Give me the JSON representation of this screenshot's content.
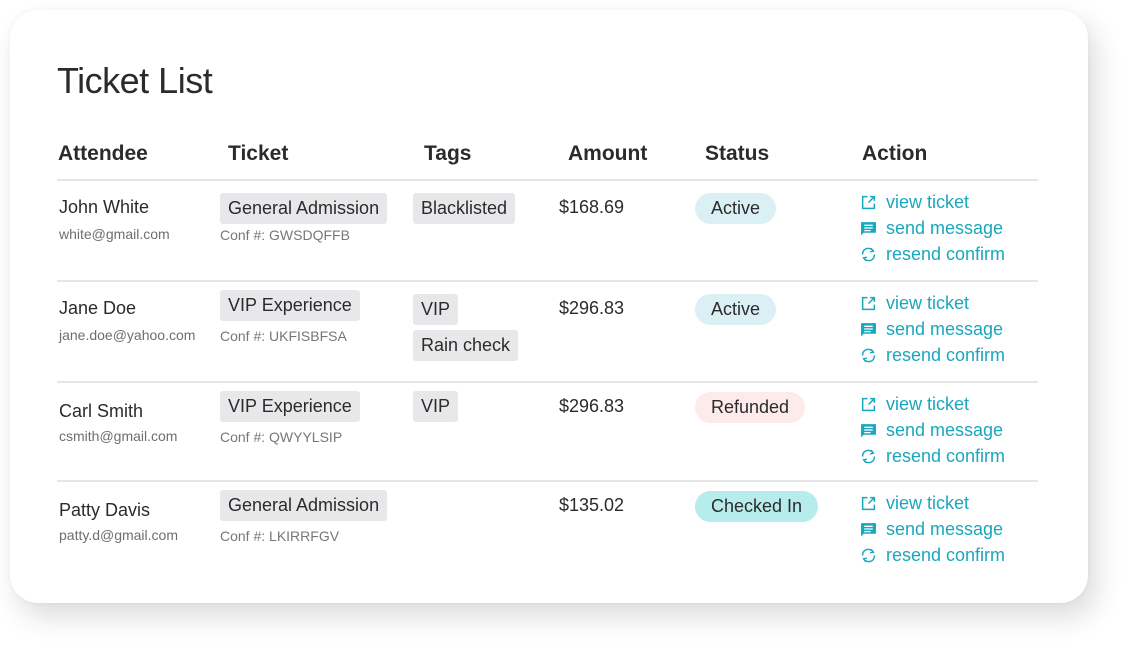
{
  "page": {
    "title": "Ticket List"
  },
  "table": {
    "columns": [
      "Attendee",
      "Ticket",
      "Tags",
      "Amount",
      "Status",
      "Action"
    ],
    "rows": [
      {
        "name": "John White",
        "email": "white@gmail.com",
        "ticket": "General Admission",
        "conf": "Conf #: GWSDQFFB",
        "tags": [
          "Blacklisted"
        ],
        "amount": "$168.69",
        "status": "Active",
        "actions": [
          "view ticket",
          "send message",
          "resend confirm"
        ]
      },
      {
        "name": "Jane Doe",
        "email": "jane.doe@yahoo.com",
        "ticket": "VIP Experience",
        "conf": "Conf #: UKFISBFSA",
        "tags": [
          "VIP",
          "Rain check"
        ],
        "amount": "$296.83",
        "status": "Active",
        "actions": [
          "view ticket",
          "send message",
          "resend confirm"
        ]
      },
      {
        "name": "Carl Smith",
        "email": "csmith@gmail.com",
        "ticket": "VIP Experience",
        "conf": "Conf #: QWYYLSIP",
        "tags": [
          "VIP"
        ],
        "amount": "$296.83",
        "status": "Refunded",
        "actions": [
          "view ticket",
          "send message",
          "resend confirm"
        ]
      },
      {
        "name": "Patty Davis",
        "email": "patty.d@gmail.com",
        "ticket": "General Admission",
        "conf": "Conf #: LKIRRFGV",
        "tags": [],
        "amount": "$135.02",
        "status": "Checked In",
        "actions": [
          "view ticket",
          "send message",
          "resend confirm"
        ]
      }
    ]
  },
  "icons": {
    "view_ticket": "external-edit-icon",
    "send_message": "message-icon",
    "resend_confirm": "refresh-icon"
  },
  "colors": {
    "accent": "#19a7bd",
    "status_active": "#dbf0f5",
    "status_refunded": "#fdeaea",
    "status_checked_in": "#b6ecec",
    "chip_bg": "#e8e8ea"
  }
}
